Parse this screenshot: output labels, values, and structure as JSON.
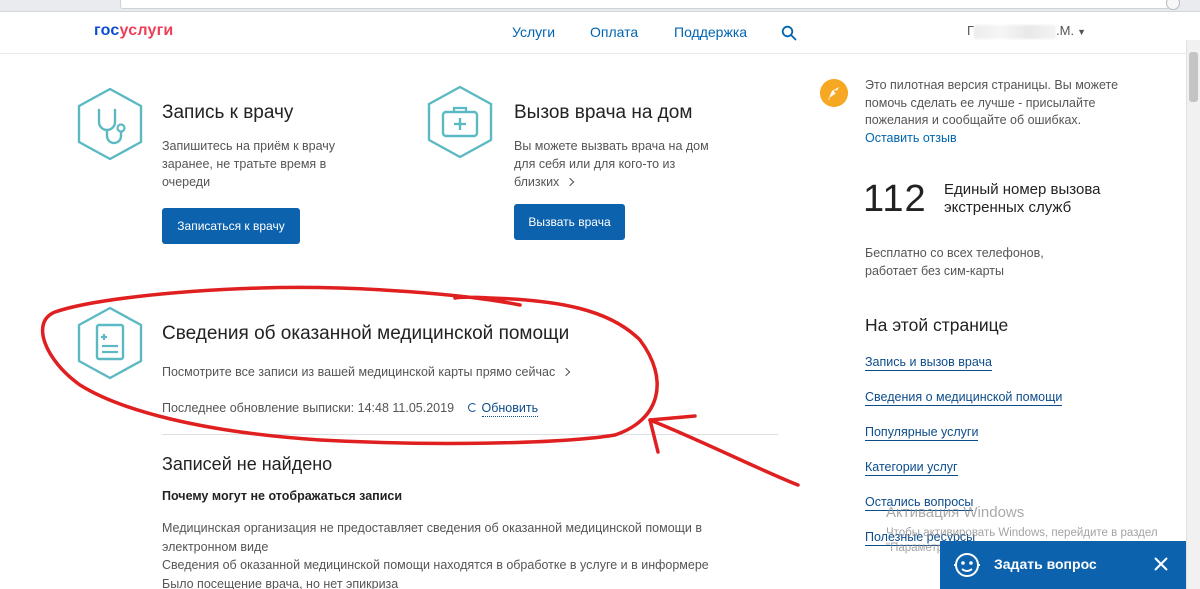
{
  "header": {
    "logo_part1": "гос",
    "logo_part2": "услуги",
    "nav": [
      "Услуги",
      "Оплата",
      "Поддержка"
    ],
    "user_initials": "Г",
    "user_suffix": ".М."
  },
  "services": [
    {
      "title": "Запись к врачу",
      "desc_lines": [
        "Запишитесь на приём к врачу",
        "заранее, не тратьте время в",
        "очереди"
      ],
      "button": "Записаться к врачу",
      "icon": "stethoscope-icon"
    },
    {
      "title": "Вызов врача на дом",
      "desc_lines": [
        "Вы можете вызвать врача на дом",
        "для себя или для кого-то из",
        "близких"
      ],
      "button": "Вызвать врача",
      "icon": "medkit-icon"
    }
  ],
  "medical": {
    "title": "Сведения об оказанной медицинской помощи",
    "desc": "Посмотрите все записи из вашей медицинской карты прямо сейчас",
    "updated_label": "Последнее обновление выписки: 14:48 11.05.2019",
    "refresh": "Обновить",
    "icon": "medical-record-icon"
  },
  "records": {
    "title": "Записей не найдено",
    "subtitle": "Почему могут не отображаться записи",
    "lines": [
      "Медицинская организация не предоставляет сведения об оказанной медицинской помощи в",
      "электронном виде",
      "Сведения об оказанной медицинской помощи находятся в обработке в услуге и в информере",
      "Было посещение врача, но нет эпикриза"
    ]
  },
  "sidebar": {
    "pilot_text": "Это пилотная версия страницы. Вы можете помочь сделать ее лучше - присылайте пожелания и сообщайте об ошибках.",
    "pilot_link": "Оставить отзыв",
    "emergency_number": "112",
    "emergency_label": "Единый номер вызова экстренных служб",
    "emergency_desc": "Бесплатно со всех телефонов, работает без сим-карты",
    "onpage_title": "На этой странице",
    "onpage_links": [
      "Запись и вызов врача",
      "Сведения о медицинской помощи",
      "Популярные услуги",
      "Категории услуг",
      "Остались вопросы",
      "Полезные ресурсы"
    ]
  },
  "watermark": {
    "title": "Активация Windows",
    "subtitle": "Чтобы активировать Windows, перейдите в раздел \"Параметры\"."
  },
  "chat": {
    "label": "Задать вопрос"
  },
  "colors": {
    "brand_blue": "#0d4cd3",
    "brand_red": "#ee3f58",
    "button_blue": "#0d62ad",
    "icon_teal": "#5bb9c3",
    "annotation_red": "#e02020"
  }
}
